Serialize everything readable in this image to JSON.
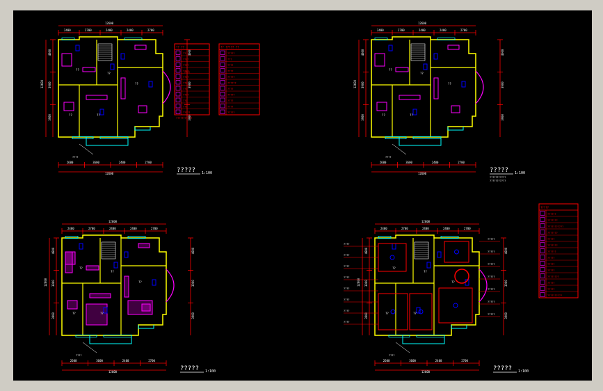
{
  "plans": [
    {
      "id": "plan-1",
      "top_overall": "12600",
      "top_segments": [
        "2400",
        "2700",
        "2400",
        "2400",
        "2700"
      ],
      "left_dims": [
        "4800",
        "3900",
        "3900"
      ],
      "left_overall": "12600",
      "right_dims": [
        "4000",
        "3900",
        "3900"
      ],
      "bottom_segments": [
        "2600",
        "3600",
        "2400",
        "2700"
      ],
      "bottom_overall": "12600",
      "title": "?????",
      "scale": "1:100",
      "subtitle": []
    },
    {
      "id": "plan-2",
      "top_overall": "12600",
      "top_segments": [
        "2400",
        "2700",
        "2400",
        "2400",
        "2700"
      ],
      "left_dims": [
        "4800",
        "3900",
        "3900"
      ],
      "left_overall": "12600",
      "right_dims": [
        "4000",
        "3900",
        "3900"
      ],
      "bottom_segments": [
        "2600",
        "3600",
        "2400",
        "2700"
      ],
      "bottom_overall": "12600",
      "title": "?????",
      "scale": "1:100",
      "subtitle": [
        "???????????",
        "???????????"
      ]
    },
    {
      "id": "plan-3",
      "top_overall": "12600",
      "top_segments": [
        "2400",
        "2700",
        "2400",
        "2400",
        "2700"
      ],
      "left_dims": [
        "4800",
        "3900",
        "3900"
      ],
      "left_overall": "12600",
      "right_dims": [
        "4000",
        "3900",
        "3900"
      ],
      "bottom_segments": [
        "2600",
        "3600",
        "2400",
        "2700"
      ],
      "bottom_overall": "12600",
      "title": "?????",
      "scale": "1:100",
      "subtitle": []
    },
    {
      "id": "plan-4",
      "top_overall": "12600",
      "top_segments": [
        "2400",
        "2700",
        "2400",
        "2400",
        "2700"
      ],
      "left_dims": [
        "4800",
        "3900",
        "3900"
      ],
      "left_overall": "12600",
      "right_dims": [
        "4000",
        "3900",
        "3900"
      ],
      "bottom_segments": [
        "2600",
        "3600",
        "2400",
        "2700"
      ],
      "bottom_overall": "12600",
      "title": "?????",
      "scale": "1:100",
      "subtitle": []
    }
  ],
  "legends": [
    {
      "id": "legend-a",
      "header": "?? ??",
      "rows": [
        "??",
        "????",
        "????",
        "????",
        "????",
        "???",
        "???",
        "????",
        "???",
        "???",
        "?????"
      ],
      "note": "???????????"
    },
    {
      "id": "legend-b",
      "header": "?? ????? ??",
      "rows": [
        "?????",
        "???",
        "????",
        "????",
        "?????",
        "??????",
        "????",
        "?????",
        "????",
        "????",
        "?????"
      ]
    },
    {
      "id": "legend-c",
      "header": "?????",
      "rows": [
        "??????",
        "???????",
        "???????????",
        "???????",
        "?????",
        "???????",
        "??????",
        "?????",
        "?????",
        "?????",
        "????????",
        "?????",
        "?????",
        "??????????"
      ]
    }
  ],
  "room_tags": [
    "??",
    "??",
    "??",
    "??",
    "??",
    "??"
  ],
  "colors": {
    "background": "#000000",
    "wall": "#ffff00",
    "dimension": "#ff0000",
    "window": "#00ffff",
    "furniture": "#ff00ff",
    "fixture": "#0000ff",
    "text": "#ffffff"
  }
}
